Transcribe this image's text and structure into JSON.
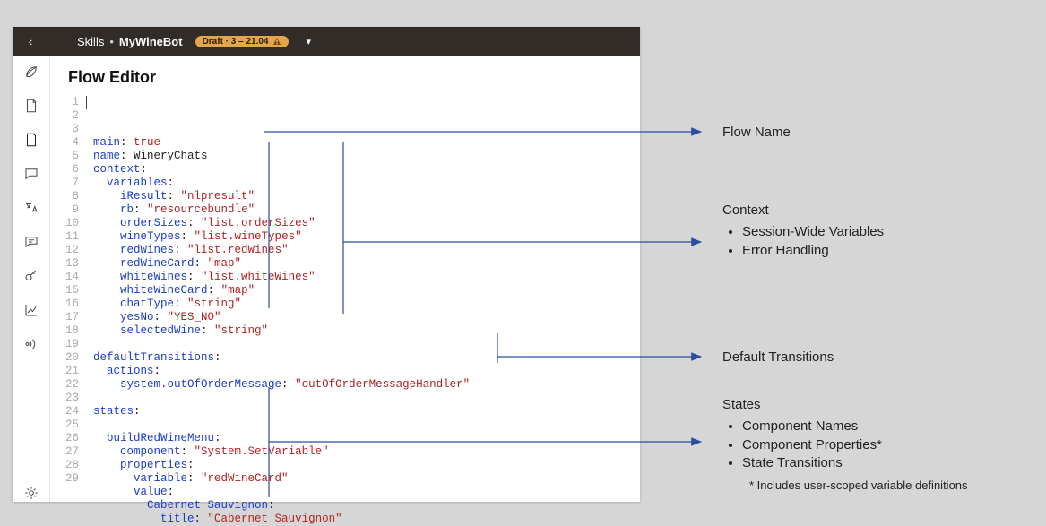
{
  "topbar": {
    "back_glyph": "‹",
    "crumb_root": "Skills",
    "crumb_sep": "•",
    "crumb_skill": "MyWineBot",
    "badge_text": "Draft · 3 – 21.04",
    "dropdown_caret": "▾"
  },
  "title": "Flow Editor",
  "sidebar_icons": [
    "leaf-icon",
    "document-icon",
    "file-icon",
    "chat-icon",
    "translate-icon",
    "comment-icon",
    "key-icon",
    "chart-icon",
    "broadcast-icon",
    "gear-icon"
  ],
  "code": {
    "lines": [
      {
        "n": 1,
        "seg": [
          [
            "key",
            "main"
          ],
          [
            "p",
            ": "
          ],
          [
            "val",
            "true"
          ]
        ]
      },
      {
        "n": 2,
        "seg": [
          [
            "key",
            "name"
          ],
          [
            "p",
            ": "
          ],
          [
            "p",
            "WineryChats"
          ]
        ]
      },
      {
        "n": 3,
        "seg": [
          [
            "key",
            "context"
          ],
          [
            "p",
            ":"
          ]
        ]
      },
      {
        "n": 4,
        "seg": [
          [
            "p",
            "  "
          ],
          [
            "key",
            "variables"
          ],
          [
            "p",
            ":"
          ]
        ]
      },
      {
        "n": 5,
        "seg": [
          [
            "p",
            "    "
          ],
          [
            "key",
            "iResult"
          ],
          [
            "p",
            ": "
          ],
          [
            "str",
            "\"nlpresult\""
          ]
        ]
      },
      {
        "n": 6,
        "seg": [
          [
            "p",
            "    "
          ],
          [
            "key",
            "rb"
          ],
          [
            "p",
            ": "
          ],
          [
            "str",
            "\"resourcebundle\""
          ]
        ]
      },
      {
        "n": 7,
        "seg": [
          [
            "p",
            "    "
          ],
          [
            "key",
            "orderSizes"
          ],
          [
            "p",
            ": "
          ],
          [
            "str",
            "\"list.orderSizes\""
          ]
        ]
      },
      {
        "n": 8,
        "seg": [
          [
            "p",
            "    "
          ],
          [
            "key",
            "wineTypes"
          ],
          [
            "p",
            ": "
          ],
          [
            "str",
            "\"list.wineTypes\""
          ]
        ]
      },
      {
        "n": 9,
        "seg": [
          [
            "p",
            "    "
          ],
          [
            "key",
            "redWines"
          ],
          [
            "p",
            ": "
          ],
          [
            "str",
            "\"list.redWines\""
          ]
        ]
      },
      {
        "n": 10,
        "seg": [
          [
            "p",
            "    "
          ],
          [
            "key",
            "redWineCard"
          ],
          [
            "p",
            ": "
          ],
          [
            "str",
            "\"map\""
          ]
        ]
      },
      {
        "n": 11,
        "seg": [
          [
            "p",
            "    "
          ],
          [
            "key",
            "whiteWines"
          ],
          [
            "p",
            ": "
          ],
          [
            "str",
            "\"list.whiteWines\""
          ]
        ]
      },
      {
        "n": 12,
        "seg": [
          [
            "p",
            "    "
          ],
          [
            "key",
            "whiteWineCard"
          ],
          [
            "p",
            ": "
          ],
          [
            "str",
            "\"map\""
          ]
        ]
      },
      {
        "n": 13,
        "seg": [
          [
            "p",
            "    "
          ],
          [
            "key",
            "chatType"
          ],
          [
            "p",
            ": "
          ],
          [
            "str",
            "\"string\""
          ]
        ]
      },
      {
        "n": 14,
        "seg": [
          [
            "p",
            "    "
          ],
          [
            "key",
            "yesNo"
          ],
          [
            "p",
            ": "
          ],
          [
            "str",
            "\"YES_NO\""
          ]
        ]
      },
      {
        "n": 15,
        "seg": [
          [
            "p",
            "    "
          ],
          [
            "key",
            "selectedWine"
          ],
          [
            "p",
            ": "
          ],
          [
            "str",
            "\"string\""
          ]
        ]
      },
      {
        "n": 16,
        "seg": []
      },
      {
        "n": 17,
        "seg": [
          [
            "key",
            "defaultTransitions"
          ],
          [
            "p",
            ":"
          ]
        ]
      },
      {
        "n": 18,
        "seg": [
          [
            "p",
            "  "
          ],
          [
            "key",
            "actions"
          ],
          [
            "p",
            ":"
          ]
        ]
      },
      {
        "n": 19,
        "seg": [
          [
            "p",
            "    "
          ],
          [
            "key",
            "system.outOfOrderMessage"
          ],
          [
            "p",
            ": "
          ],
          [
            "str",
            "\"outOfOrderMessageHandler\""
          ]
        ]
      },
      {
        "n": 20,
        "seg": []
      },
      {
        "n": 21,
        "seg": [
          [
            "key",
            "states"
          ],
          [
            "p",
            ":"
          ]
        ]
      },
      {
        "n": 22,
        "seg": []
      },
      {
        "n": 23,
        "seg": [
          [
            "p",
            "  "
          ],
          [
            "key",
            "buildRedWineMenu"
          ],
          [
            "p",
            ":"
          ]
        ]
      },
      {
        "n": 24,
        "seg": [
          [
            "p",
            "    "
          ],
          [
            "key",
            "component"
          ],
          [
            "p",
            ": "
          ],
          [
            "str",
            "\"System.SetVariable\""
          ]
        ]
      },
      {
        "n": 25,
        "seg": [
          [
            "p",
            "    "
          ],
          [
            "key",
            "properties"
          ],
          [
            "p",
            ":"
          ]
        ]
      },
      {
        "n": 26,
        "seg": [
          [
            "p",
            "      "
          ],
          [
            "key",
            "variable"
          ],
          [
            "p",
            ": "
          ],
          [
            "str",
            "\"redWineCard\""
          ]
        ]
      },
      {
        "n": 27,
        "seg": [
          [
            "p",
            "      "
          ],
          [
            "key",
            "value"
          ],
          [
            "p",
            ":"
          ]
        ]
      },
      {
        "n": 28,
        "seg": [
          [
            "p",
            "        "
          ],
          [
            "key",
            "Cabernet Sauvignon"
          ],
          [
            "p",
            ":"
          ]
        ]
      },
      {
        "n": 29,
        "seg": [
          [
            "p",
            "          "
          ],
          [
            "key",
            "title"
          ],
          [
            "p",
            ": "
          ],
          [
            "str",
            "\"Cabernet Sauvignon\""
          ]
        ]
      }
    ]
  },
  "annotations": {
    "flow_name": "Flow Name",
    "context_hd": "Context",
    "context_items": [
      "Session-Wide Variables",
      "Error Handling"
    ],
    "default_transitions": "Default Transitions",
    "states_hd": "States",
    "states_items": [
      "Component Names",
      "Component Properties*",
      "State Transitions"
    ],
    "states_footnote": "* Includes user-scoped variable definitions"
  }
}
